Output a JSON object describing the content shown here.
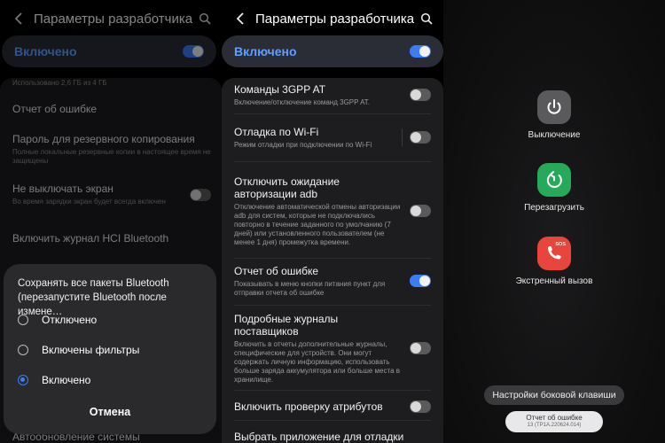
{
  "colors": {
    "accent": "#3b7df8",
    "toggle_off": "#5a5a5a",
    "power_gray": "#5a5a5d",
    "restart_green": "#27a95a",
    "sos_red": "#e8453c"
  },
  "header": {
    "title": "Параметры разработчика",
    "back_icon": "chevron-left-icon",
    "search_icon": "search-icon"
  },
  "master_switch": {
    "label": "Включено",
    "state": "on"
  },
  "left_panel": {
    "items": [
      {
        "title": "",
        "subtitle": "Использовано 2,6 ГБ из 4 ГБ"
      },
      {
        "title": "Отчет об ошибке",
        "subtitle": ""
      },
      {
        "title": "Пароль для резервного копирования",
        "subtitle": "Полные локальные резервные копии в настоящее время не защищены"
      },
      {
        "title": "Не выключать экран",
        "subtitle": "Во время зарядки экран будет всегда включен",
        "toggle": "off"
      },
      {
        "title": "Включить журнал HCI Bluetooth",
        "subtitle": ""
      },
      {
        "title": "Автообновление системы",
        "subtitle": ""
      }
    ],
    "dialog": {
      "title": "Сохранять все пакеты Bluetooth (перезапустите Bluetooth после измене…",
      "options": [
        {
          "label": "Отключено",
          "selected": false
        },
        {
          "label": "Включены фильтры",
          "selected": false
        },
        {
          "label": "Включено",
          "selected": true
        }
      ],
      "cancel": "Отмена"
    }
  },
  "main_panel": {
    "items": [
      {
        "title": "Команды 3GPP AT",
        "subtitle": "Включение/отключение команд 3GPP AT.",
        "toggle": "off"
      },
      {
        "title": "Отладка по Wi-Fi",
        "subtitle": "Режим отладки при подключении по Wi-Fi",
        "toggle": "off"
      },
      {
        "title": "Отключить ожидание авторизации adb",
        "subtitle": "Отключение автоматической отмены авторизации adb для систем, которые не подключались повторно в течение заданного по умолчанию (7 дней) или установленного пользователем (не менее 1 дня) промежутка времени.",
        "toggle": "off"
      },
      {
        "title": "Отчет об ошибке",
        "subtitle": "Показывать в меню кнопки питания пункт для отправки отчета об ошибке",
        "toggle": "on"
      },
      {
        "title": "Подробные журналы поставщиков",
        "subtitle": "Включить в отчеты дополнительные журналы, специфические для устройств. Они могут содержать личную информацию, использовать больше заряда аккумулятора или больше места в хранилище.",
        "toggle": "off"
      },
      {
        "title": "Включить проверку атрибутов",
        "subtitle": "",
        "toggle": "off"
      },
      {
        "title": "Выбрать приложение для отладки",
        "subtitle": ""
      }
    ]
  },
  "power_menu": {
    "buttons": [
      {
        "label": "Выключение",
        "icon": "power-icon"
      },
      {
        "label": "Перезагрузить",
        "icon": "restart-icon"
      },
      {
        "label": "Экстренный вызов",
        "icon": "sos-phone-icon",
        "badge": "SOS"
      }
    ],
    "side_key_label": "Настройки боковой клавиши",
    "bug_report_label": "Отчет об ошибке",
    "bug_report_build": "13 (TP1A.220624.014)"
  }
}
